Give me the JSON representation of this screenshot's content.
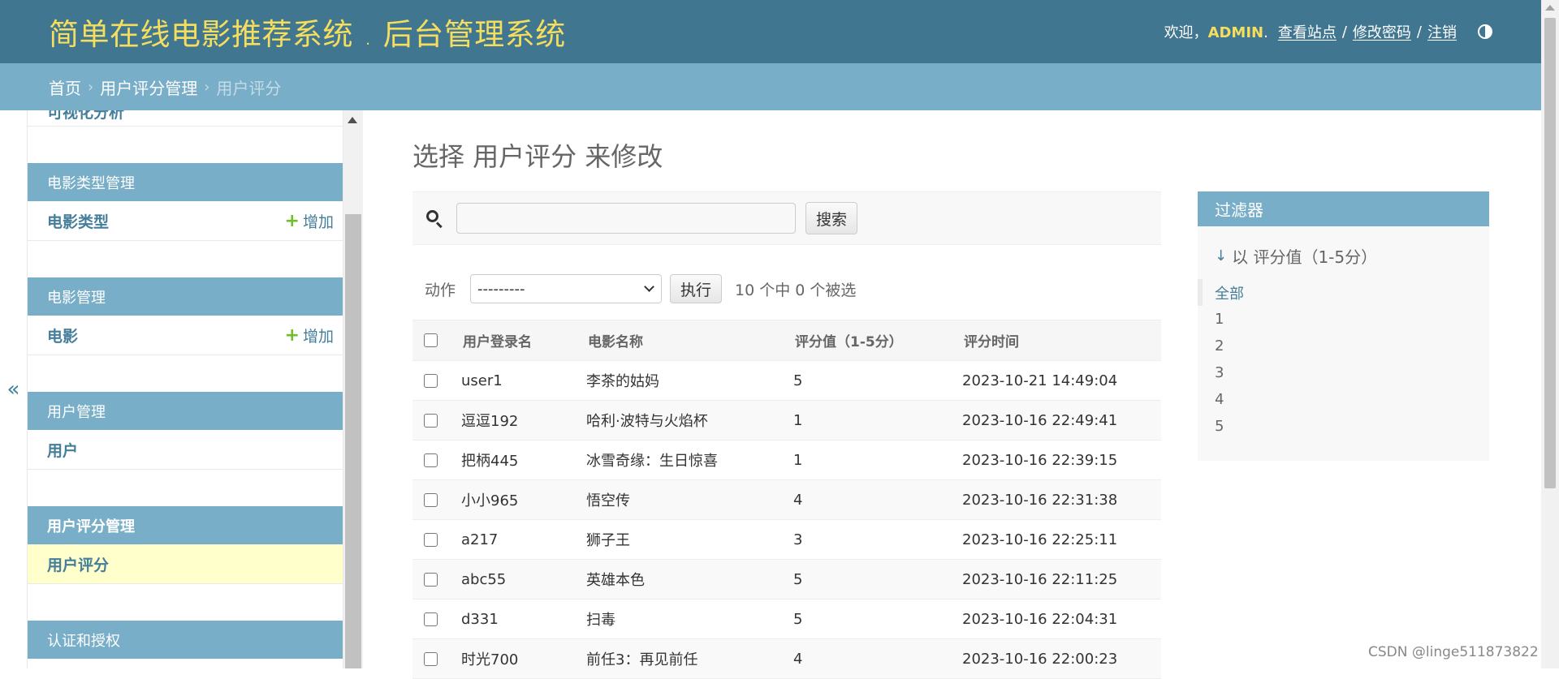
{
  "header": {
    "branding": "简单在线电影推荐系统 . 后台管理系统",
    "welcome": "欢迎，",
    "username": "ADMIN",
    "view_site": "查看站点",
    "change_password": "修改密码",
    "logout": "注销",
    "separator": "/"
  },
  "breadcrumbs": {
    "home": "首页",
    "app": "用户评分管理",
    "current": "用户评分",
    "sep": "›"
  },
  "nav_toggle": "«",
  "sidebar": {
    "partial_label": "可视化分析",
    "add_label": "增加",
    "modules": [
      {
        "caption": "电影类型管理",
        "rows": [
          {
            "label": "电影类型",
            "has_add": true
          }
        ]
      },
      {
        "caption": "电影管理",
        "rows": [
          {
            "label": "电影",
            "has_add": true
          }
        ]
      },
      {
        "caption": "用户管理",
        "rows": [
          {
            "label": "用户",
            "has_add": false
          }
        ]
      },
      {
        "caption": "用户评分管理",
        "rows": [
          {
            "label": "用户评分",
            "has_add": false
          }
        ]
      },
      {
        "caption": "认证和授权",
        "rows": []
      }
    ]
  },
  "content": {
    "title": "选择 用户评分 来修改",
    "search_button": "搜索",
    "search_value": "",
    "action_label": "动作",
    "action_selected": "---------",
    "go_button": "执行",
    "counter": "10 个中 0 个被选"
  },
  "table": {
    "headers": [
      "用户登录名",
      "电影名称",
      "评分值（1-5分）",
      "评分时间"
    ],
    "rows": [
      {
        "user": "user1",
        "movie": "李茶的姑妈",
        "score": "5",
        "time": "2023-10-21 14:49:04"
      },
      {
        "user": "逗逗192",
        "movie": "哈利·波特与火焰杯",
        "score": "1",
        "time": "2023-10-16 22:49:41"
      },
      {
        "user": "把柄445",
        "movie": "冰雪奇缘：生日惊喜",
        "score": "1",
        "time": "2023-10-16 22:39:15"
      },
      {
        "user": "小小965",
        "movie": "悟空传",
        "score": "4",
        "time": "2023-10-16 22:31:38"
      },
      {
        "user": "a217",
        "movie": "狮子王",
        "score": "3",
        "time": "2023-10-16 22:25:11"
      },
      {
        "user": "abc55",
        "movie": "英雄本色",
        "score": "5",
        "time": "2023-10-16 22:11:25"
      },
      {
        "user": "d331",
        "movie": "扫毒",
        "score": "5",
        "time": "2023-10-16 22:04:31"
      },
      {
        "user": "时光700",
        "movie": "前任3：再见前任",
        "score": "4",
        "time": "2023-10-16 22:00:23"
      }
    ]
  },
  "filter": {
    "title": "过滤器",
    "arrow": "↓",
    "by": "以 评分值（1-5分）",
    "options": [
      "全部",
      "1",
      "2",
      "3",
      "4",
      "5"
    ]
  },
  "watermark": "CSDN @linge511873822",
  "colors": {
    "header_bg": "#417690",
    "branding": "#f5dd5d",
    "breadcrumbs_bg": "#79aec8",
    "link": "#447e9b",
    "current_row": "#ffffcc",
    "add_icon": "#70bf2b"
  }
}
